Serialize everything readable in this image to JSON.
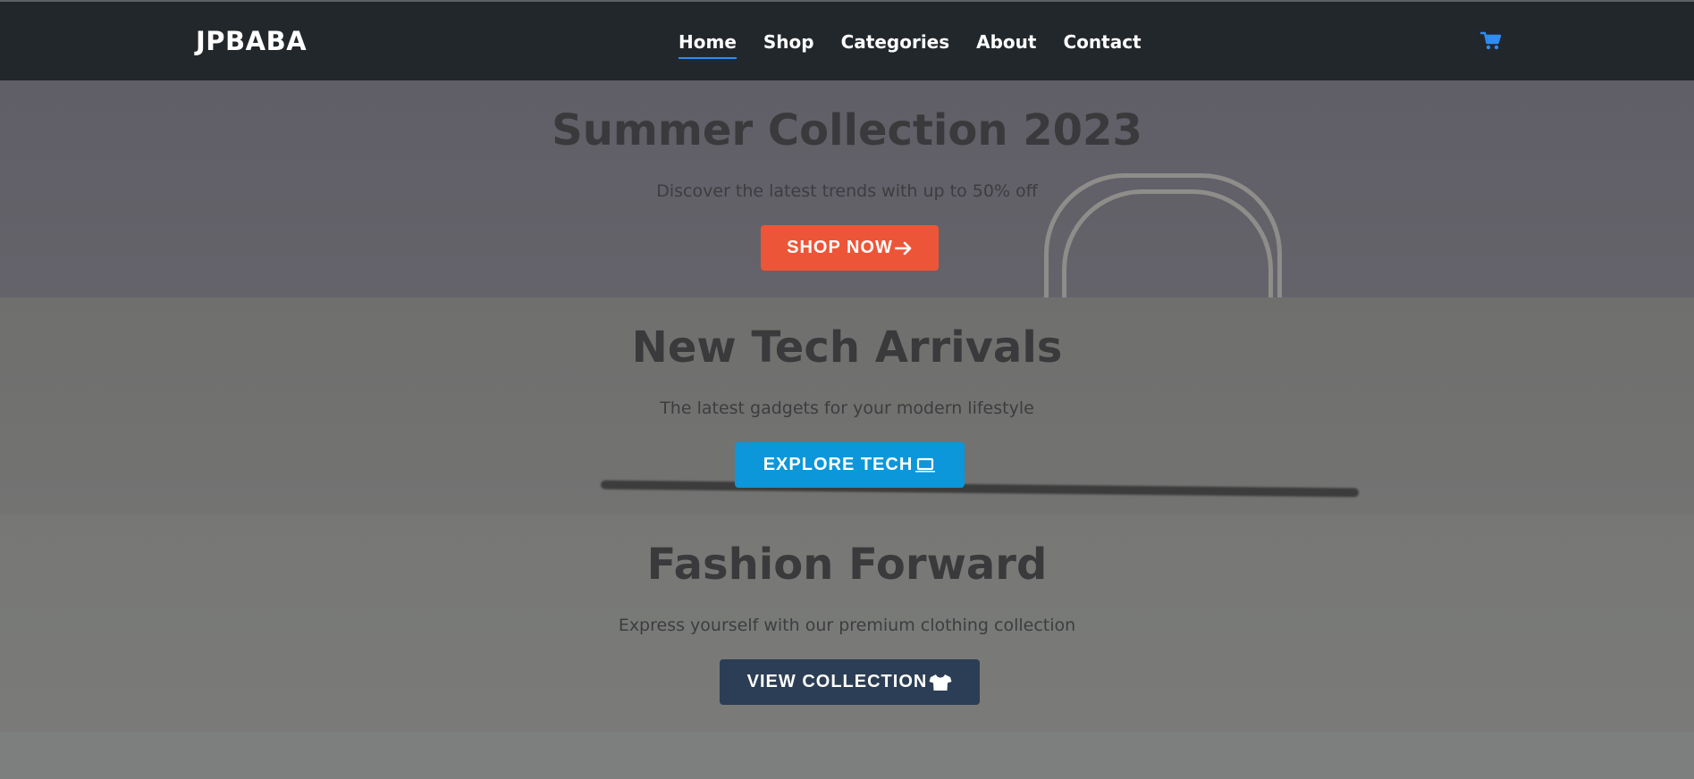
{
  "brand": {
    "name": "JPBABA"
  },
  "nav": {
    "items": [
      {
        "label": "Home",
        "active": true
      },
      {
        "label": "Shop",
        "active": false
      },
      {
        "label": "Categories",
        "active": false
      },
      {
        "label": "About",
        "active": false
      },
      {
        "label": "Contact",
        "active": false
      }
    ],
    "cart_icon": "shopping-cart-icon",
    "accent_color": "#2f8cf0"
  },
  "heroes": [
    {
      "title": "Summer Collection 2023",
      "subtitle": "Discover the latest trends with up to 50% off",
      "button": {
        "label": "SHOP NOW",
        "icon": "arrow-right-icon",
        "color": "#ed5538"
      }
    },
    {
      "title": "New Tech Arrivals",
      "subtitle": "The latest gadgets for your modern lifestyle",
      "button": {
        "label": "EXPLORE TECH",
        "icon": "laptop-icon",
        "color": "#0b97d9"
      }
    },
    {
      "title": "Fashion Forward",
      "subtitle": "Express yourself with our premium clothing collection",
      "button": {
        "label": "VIEW COLLECTION",
        "icon": "tshirt-icon",
        "color": "#2c3e55"
      }
    }
  ]
}
